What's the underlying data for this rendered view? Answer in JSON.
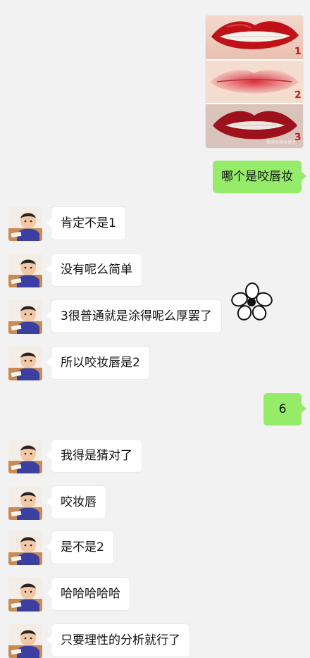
{
  "image_message": {
    "numbers": [
      "1",
      "2",
      "3"
    ],
    "watermark": "微博@美妆博主"
  },
  "messages": [
    {
      "side": "right",
      "text": "哪个是咬唇妆"
    },
    {
      "side": "left",
      "text": "肯定不是1"
    },
    {
      "side": "left",
      "text": "没有呢么简单"
    },
    {
      "side": "left",
      "text": "3很普通就是涂得呢么厚罢了"
    },
    {
      "side": "left",
      "text": "所以咬妆唇是2"
    },
    {
      "side": "right",
      "text": "6"
    },
    {
      "side": "left",
      "text": "我得是猜对了"
    },
    {
      "side": "left",
      "text": "咬妆唇"
    },
    {
      "side": "left",
      "text": "是不是2"
    },
    {
      "side": "left",
      "text": "哈哈哈哈哈"
    },
    {
      "side": "left",
      "text": "只要理性的分析就行了"
    }
  ],
  "colors": {
    "background": "#f2f2f2",
    "outgoing_bubble": "#95ec69",
    "incoming_bubble": "#ffffff"
  },
  "sticker": "flower-icon",
  "avatar": "child-avatar"
}
